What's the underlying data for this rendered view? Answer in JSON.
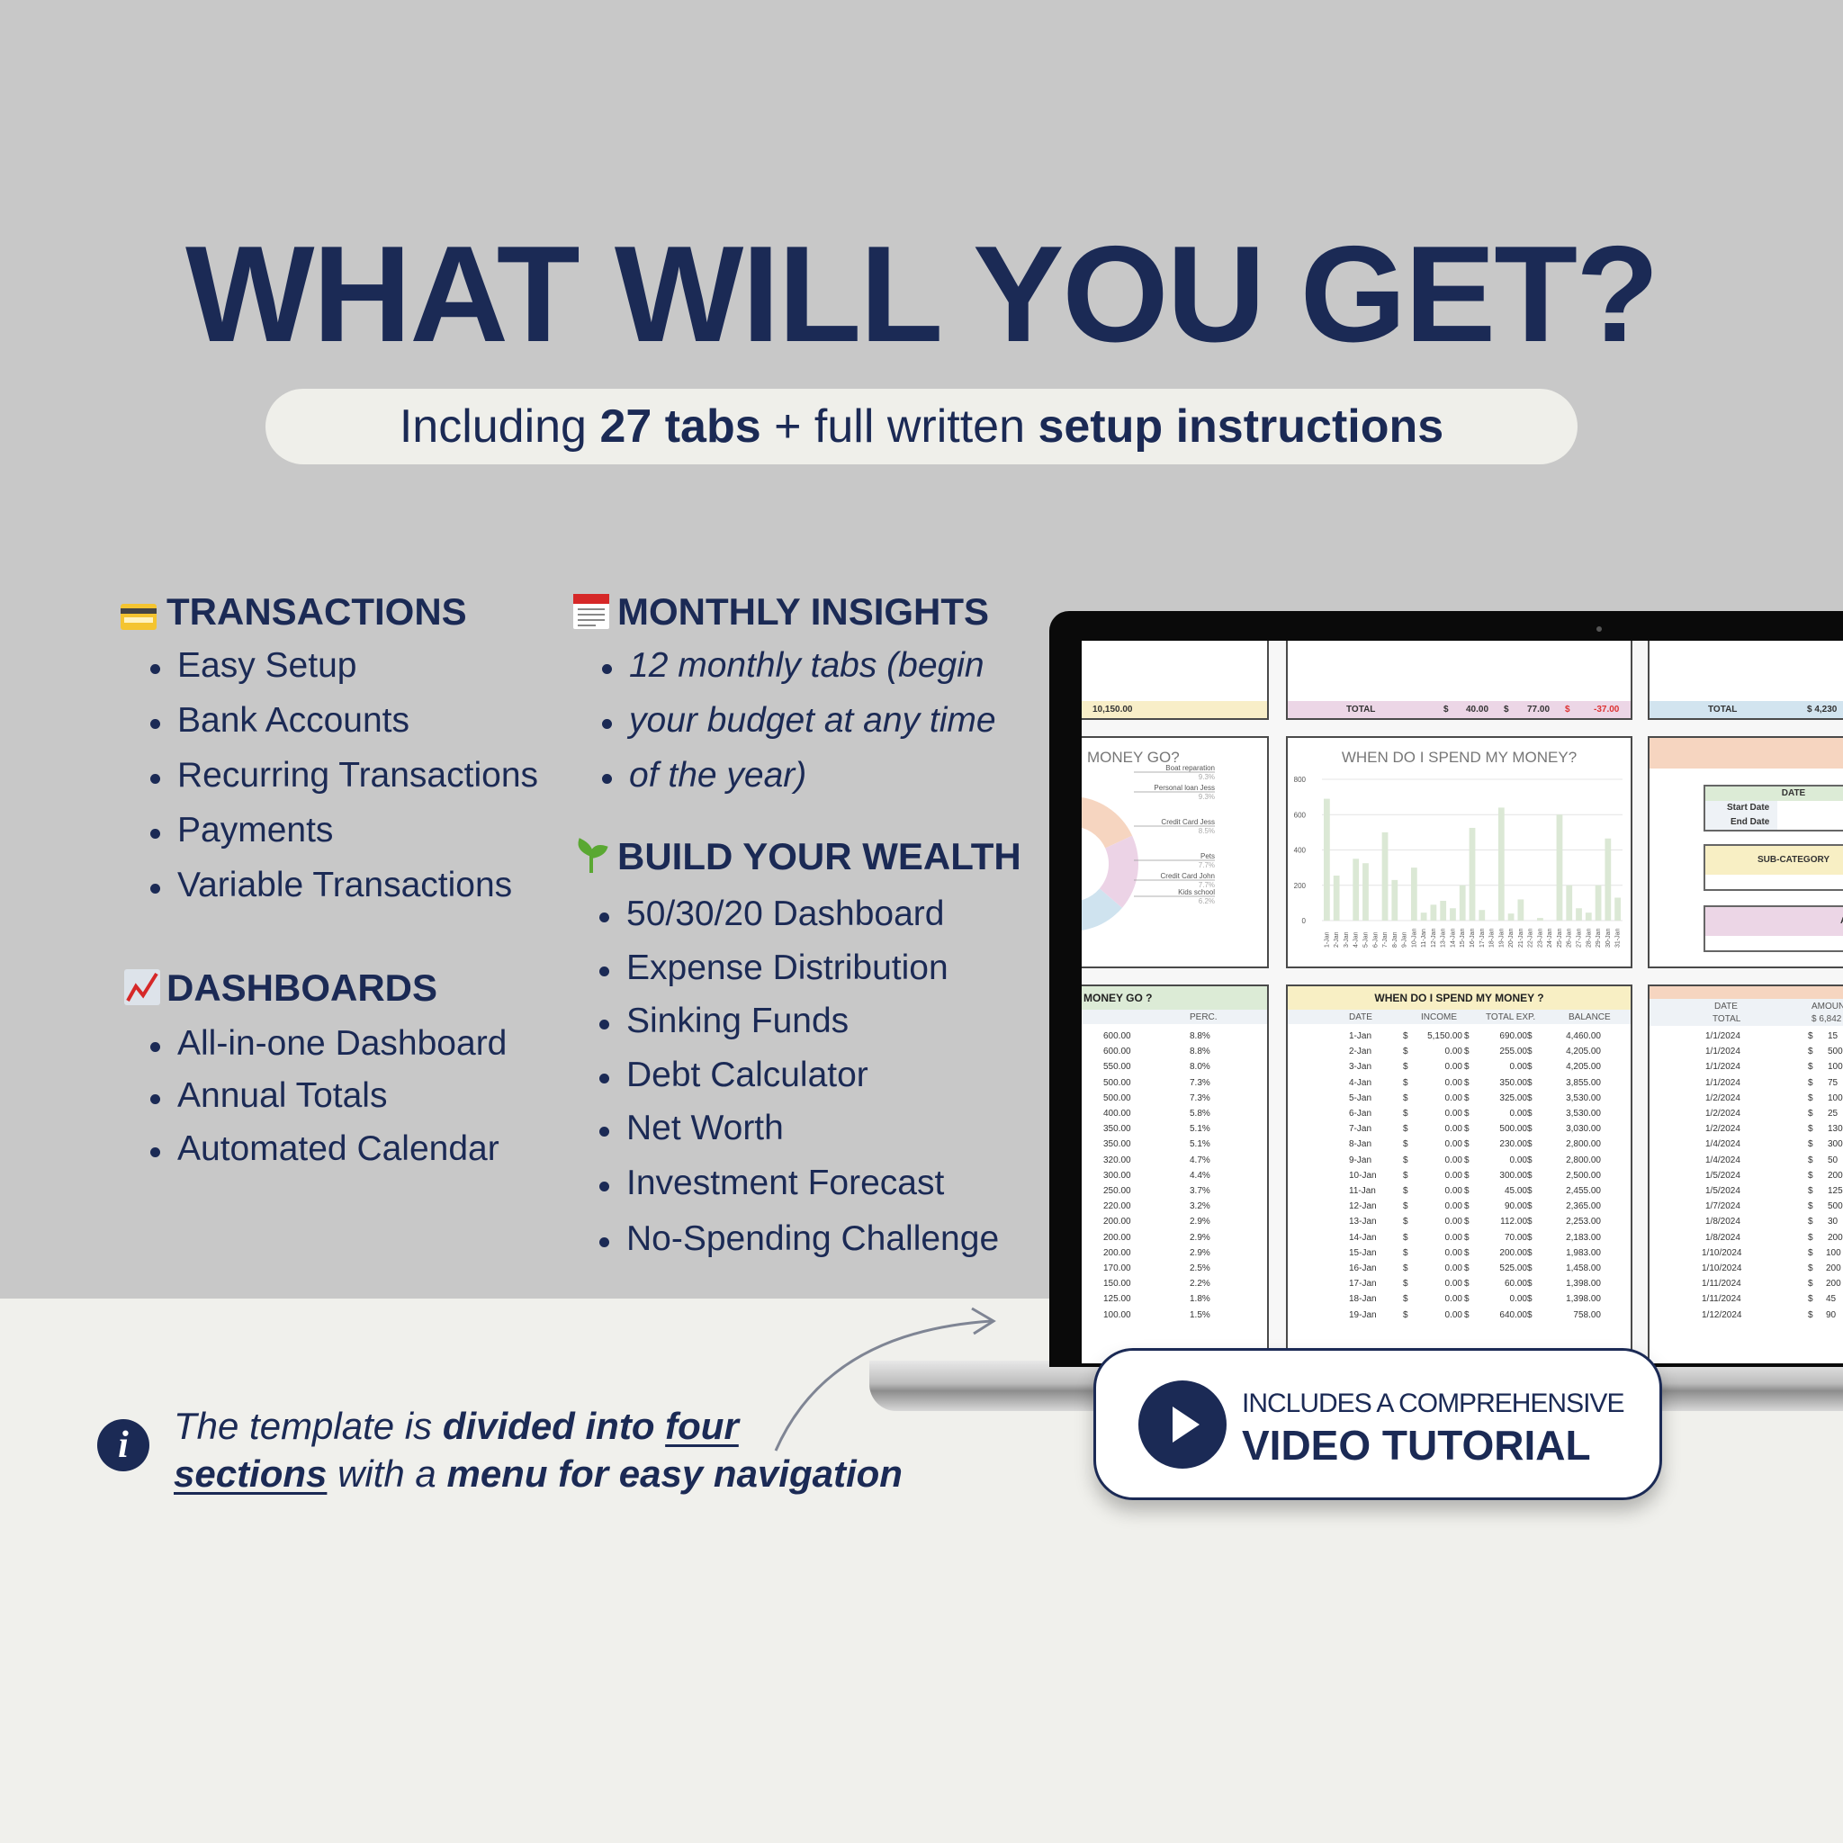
{
  "title": "WHAT WILL YOU GET?",
  "subtitle": {
    "pre": "Including ",
    "tabs": "27 tabs",
    "mid": " + full written ",
    "setup": "setup instructions"
  },
  "sections": {
    "transactions": {
      "heading": "TRANSACTIONS",
      "icon": "credit-card-icon",
      "items": [
        "Easy Setup",
        "Bank Accounts",
        "Recurring Transactions",
        "Payments",
        "Variable Transactions"
      ]
    },
    "dashboards": {
      "heading": "DASHBOARDS",
      "icon": "chart-increasing-icon",
      "items": [
        "All-in-one Dashboard",
        "Annual Totals",
        "Automated Calendar"
      ]
    },
    "monthly": {
      "heading": "MONTHLY INSIGHTS",
      "icon": "calendar-icon",
      "items": [
        "12 monthly tabs (begin",
        "your budget at any time",
        "of the year)"
      ]
    },
    "wealth": {
      "heading": "BUILD YOUR WEALTH",
      "icon": "seedling-icon",
      "items": [
        "50/30/20 Dashboard",
        "Expense Distribution",
        "Sinking Funds",
        "Debt Calculator",
        "Net Worth",
        "Investment Forecast",
        "No-Spending Challenge"
      ]
    }
  },
  "spreadsheet": {
    "top_left_total": "10,150.00",
    "top_mid": {
      "label": "TOTAL",
      "cur": "$",
      "v1": "40.00",
      "v2": "77.00",
      "v3": "-37.00"
    },
    "top_right": {
      "label": "TOTAL",
      "value": "$ 4,230"
    },
    "donut": {
      "title": "MONEY GO?",
      "labels": [
        [
          "Boat reparation",
          "9.3%"
        ],
        [
          "Personal loan Jess",
          "9.3%"
        ],
        [
          "Credit Card Jess",
          "8.5%"
        ],
        [
          "Pets",
          "7.7%"
        ],
        [
          "Credit Card John",
          "7.7%"
        ],
        [
          "Kids school",
          "6.2%"
        ]
      ],
      "colors": [
        "#f6d5c0",
        "#ecd3e6",
        "#cfe3ef",
        "#d8e8d3",
        "#f8efc4",
        "#e6ecf2"
      ]
    },
    "bar_chart": {
      "title": "WHEN DO I SPEND MY MONEY?",
      "yticks": [
        "0",
        "200",
        "400",
        "600",
        "800"
      ],
      "ymax": 800,
      "bar_color": "#dbe8d5",
      "values": [
        690,
        255,
        0,
        350,
        325,
        0,
        500,
        230,
        0,
        300,
        45,
        90,
        112,
        70,
        200,
        525,
        60,
        0,
        640,
        40,
        120,
        0,
        15,
        0,
        600,
        200,
        70,
        45,
        200,
        465,
        130
      ]
    },
    "filters": {
      "date": "DATE",
      "start": "Start Date",
      "end": "End Date",
      "sub": "SUB-CATEGORY",
      "a": "A"
    },
    "left_table": {
      "title": "MONEY GO ?",
      "perc": "PERC.",
      "amounts": [
        "600.00",
        "600.00",
        "550.00",
        "500.00",
        "500.00",
        "400.00",
        "350.00",
        "350.00",
        "320.00",
        "300.00",
        "250.00",
        "220.00",
        "200.00",
        "200.00",
        "200.00",
        "170.00",
        "150.00",
        "125.00",
        "100.00"
      ],
      "percs": [
        "8.8%",
        "8.8%",
        "8.0%",
        "7.3%",
        "7.3%",
        "5.8%",
        "5.1%",
        "5.1%",
        "4.7%",
        "4.4%",
        "3.7%",
        "3.2%",
        "2.9%",
        "2.9%",
        "2.9%",
        "2.5%",
        "2.2%",
        "1.8%",
        "1.5%"
      ]
    },
    "mid_table": {
      "title": "WHEN DO I SPEND MY MONEY ?",
      "headers": [
        "DATE",
        "INCOME",
        "TOTAL EXP.",
        "BALANCE"
      ],
      "rows": [
        [
          "1-Jan",
          "5,150.00",
          "690.00",
          "4,460.00"
        ],
        [
          "2-Jan",
          "0.00",
          "255.00",
          "4,205.00"
        ],
        [
          "3-Jan",
          "0.00",
          "0.00",
          "4,205.00"
        ],
        [
          "4-Jan",
          "0.00",
          "350.00",
          "3,855.00"
        ],
        [
          "5-Jan",
          "0.00",
          "325.00",
          "3,530.00"
        ],
        [
          "6-Jan",
          "0.00",
          "0.00",
          "3,530.00"
        ],
        [
          "7-Jan",
          "0.00",
          "500.00",
          "3,030.00"
        ],
        [
          "8-Jan",
          "0.00",
          "230.00",
          "2,800.00"
        ],
        [
          "9-Jan",
          "0.00",
          "0.00",
          "2,800.00"
        ],
        [
          "10-Jan",
          "0.00",
          "300.00",
          "2,500.00"
        ],
        [
          "11-Jan",
          "0.00",
          "45.00",
          "2,455.00"
        ],
        [
          "12-Jan",
          "0.00",
          "90.00",
          "2,365.00"
        ],
        [
          "13-Jan",
          "0.00",
          "112.00",
          "2,253.00"
        ],
        [
          "14-Jan",
          "0.00",
          "70.00",
          "2,183.00"
        ],
        [
          "15-Jan",
          "0.00",
          "200.00",
          "1,983.00"
        ],
        [
          "16-Jan",
          "0.00",
          "525.00",
          "1,458.00"
        ],
        [
          "17-Jan",
          "0.00",
          "60.00",
          "1,398.00"
        ],
        [
          "18-Jan",
          "0.00",
          "0.00",
          "1,398.00"
        ],
        [
          "19-Jan",
          "0.00",
          "640.00",
          "758.00"
        ]
      ]
    },
    "right_table": {
      "date": "DATE",
      "amount": "AMOUN",
      "total": "TOTAL",
      "total_value": "$ 6,842",
      "dates": [
        "1/1/2024",
        "1/1/2024",
        "1/1/2024",
        "1/1/2024",
        "1/2/2024",
        "1/2/2024",
        "1/2/2024",
        "1/4/2024",
        "1/4/2024",
        "1/5/2024",
        "1/5/2024",
        "1/7/2024",
        "1/8/2024",
        "1/8/2024",
        "1/10/2024",
        "1/10/2024",
        "1/11/2024",
        "1/11/2024",
        "1/12/2024"
      ],
      "amounts": [
        "15",
        "500",
        "100",
        "75",
        "100",
        "25",
        "130",
        "300",
        "50",
        "200",
        "125",
        "500",
        "30",
        "200",
        "100",
        "200",
        "200",
        "45",
        "90"
      ]
    }
  },
  "badge": {
    "line1": "INCLUDES A COMPREHENSIVE",
    "line2": "VIDEO TUTORIAL",
    "icon": "play-icon"
  },
  "note": {
    "l1a": "The template is ",
    "l1b": "divided into ",
    "l1c": "four",
    "l2a": "sections",
    "l2b": " with a ",
    "l2c": "menu for easy navigation"
  },
  "colors": {
    "navy": "#1b2a55",
    "gray_bg": "#c8c8c8",
    "light_bg": "#f0f0ec"
  }
}
